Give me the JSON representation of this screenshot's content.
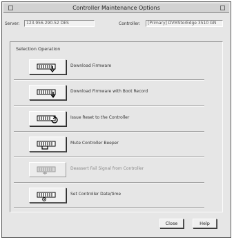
{
  "window": {
    "title": "Controller Maintenance Options"
  },
  "info": {
    "server_label": "Server:",
    "server_value": "123.956.290.52 DES",
    "controller_label": "Controller:",
    "controller_value": "[Primary] DVMStorEdge 3510 GN"
  },
  "group": {
    "label": "Selection Operation"
  },
  "operations": [
    {
      "label": "Download Firmware",
      "icon": "download-firmware-icon",
      "enabled": true
    },
    {
      "label": "Download Firmware with Boot Record",
      "icon": "download-firmware-boot-icon",
      "enabled": true
    },
    {
      "label": "Issue Reset to the Controller",
      "icon": "reset-controller-icon",
      "enabled": true
    },
    {
      "label": "Mute Controller Beeper",
      "icon": "mute-beeper-icon",
      "enabled": true
    },
    {
      "label": "Deassert Fail Signal from Controller",
      "icon": "deassert-fail-icon",
      "enabled": false
    },
    {
      "label": "Set Controller Date/time",
      "icon": "set-datetime-icon",
      "enabled": true
    }
  ],
  "buttons": {
    "close_label": "Close",
    "help_label": "Help"
  }
}
